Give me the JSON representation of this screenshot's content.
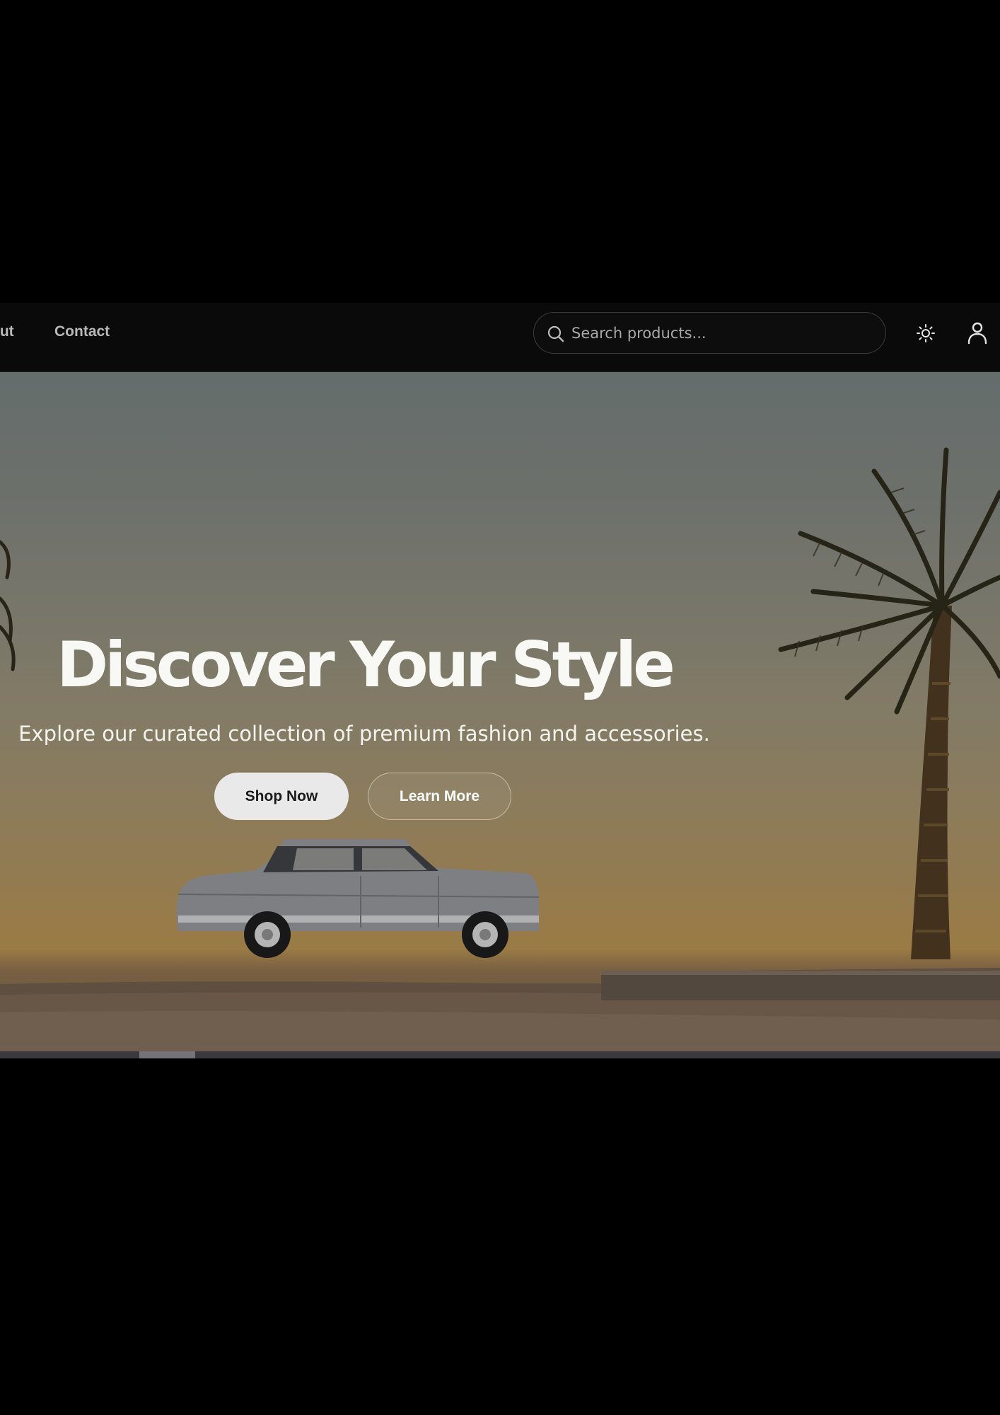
{
  "nav": {
    "links": [
      {
        "label": "About"
      },
      {
        "label": "Contact"
      }
    ],
    "visible_about_fragment": "out"
  },
  "search": {
    "placeholder": "Search products...",
    "value": ""
  },
  "icons": {
    "search": "search-icon",
    "theme": "sun-icon",
    "user": "user-icon"
  },
  "hero": {
    "title": "Discover Your Style",
    "subtitle": "Explore our curated collection of premium fashion and accessories.",
    "primary_button": "Shop Now",
    "secondary_button": "Learn More",
    "image_subject": "vintage sedan under palm trees at sunset"
  },
  "carousel": {
    "active_fraction_start": 0.14,
    "active_fraction_end": 0.195
  },
  "colors": {
    "page_background": "#000000",
    "header_background": "#0a0a0a",
    "nav_text": "#b9b9b9",
    "primary_button_bg": "#e9e9e9",
    "hero_text": "#f8f8f4"
  }
}
